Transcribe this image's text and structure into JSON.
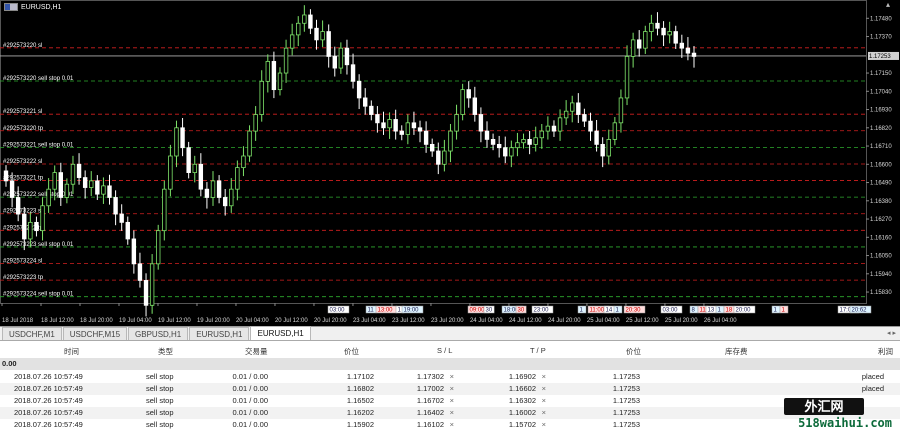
{
  "chart": {
    "symbol_title": "EURUSD,H1",
    "current_price": "1.17253",
    "price_ticks": [
      "1.17480",
      "1.17370",
      "1.17253",
      "1.17150",
      "1.17040",
      "1.16930",
      "1.16820",
      "1.16710",
      "1.16600",
      "1.16490",
      "1.16380",
      "1.16270",
      "1.16160",
      "1.16050",
      "1.15940",
      "1.15830"
    ],
    "order_lines": [
      {
        "label": "#292573220 sl",
        "price": 1.17302,
        "color": "#d42020"
      },
      {
        "label": "#292573220 sell stop 0.01",
        "price": 1.17102,
        "color": "#2eaa2e"
      },
      {
        "label": "#292573221 sl",
        "price": 1.16902,
        "color": "#d42020"
      },
      {
        "label": "#292573220 tp",
        "price": 1.16802,
        "color": "#d42020"
      },
      {
        "label": "#292573221 sell stop 0.01",
        "price": 1.16702,
        "color": "#2eaa2e"
      },
      {
        "label": "#292573222 sl",
        "price": 1.16602,
        "color": "#d42020"
      },
      {
        "label": "#292573221 tp",
        "price": 1.16502,
        "color": "#d42020"
      },
      {
        "label": "#292573222 sell stop 0.01",
        "price": 1.16402,
        "color": "#2eaa2e"
      },
      {
        "label": "#292573223 sl",
        "price": 1.16302,
        "color": "#d42020"
      },
      {
        "label": "#292573222 tp",
        "price": 1.16202,
        "color": "#d42020"
      },
      {
        "label": "#292573223 sell stop 0.01",
        "price": 1.16102,
        "color": "#2eaa2e"
      },
      {
        "label": "#292573224 sl",
        "price": 1.16002,
        "color": "#d42020"
      },
      {
        "label": "#292573223 tp",
        "price": 1.15902,
        "color": "#d42020"
      },
      {
        "label": "#292573224 sell stop 0.01",
        "price": 1.15802,
        "color": "#2eaa2e"
      }
    ],
    "time_labels": [
      "18 Jul 2018",
      "18 Jul 12:00",
      "18 Jul 20:00",
      "19 Jul 04:00",
      "19 Jul 12:00",
      "19 Jul 20:00",
      "20 Jul 04:00",
      "20 Jul 12:00",
      "20 Jul 20:00",
      "23 Jul 04:00",
      "23 Jul 12:00",
      "23 Jul 20:00",
      "24 Jul 04:00",
      "24 Jul 12:00",
      "24 Jul 20:00",
      "25 Jul 04:00",
      "25 Jul 12:00",
      "25 Jul 20:00",
      "26 Jul 04:00"
    ],
    "news_markers": [
      "03:00",
      "11",
      "13:00",
      "1",
      "19:00",
      "09:00",
      "30",
      "18:00",
      "30",
      "23:00",
      "1",
      "11:00",
      "14",
      "1",
      "20:30",
      "03:00",
      "8",
      "11",
      "13",
      "1",
      "18",
      "20:00",
      "1",
      "1",
      "17:00",
      "20:62"
    ],
    "candles_close": [
      1.165,
      1.164,
      1.163,
      1.1615,
      1.1625,
      1.162,
      1.1635,
      1.1645,
      1.1655,
      1.164,
      1.1648,
      1.166,
      1.1652,
      1.1646,
      1.165,
      1.1642,
      1.1647,
      1.164,
      1.163,
      1.1625,
      1.1615,
      1.16,
      1.159,
      1.1575,
      1.16,
      1.162,
      1.1645,
      1.1665,
      1.1682,
      1.167,
      1.1655,
      1.166,
      1.1645,
      1.164,
      1.165,
      1.164,
      1.1635,
      1.1645,
      1.1658,
      1.1665,
      1.168,
      1.169,
      1.171,
      1.1722,
      1.1705,
      1.1715,
      1.173,
      1.1738,
      1.1745,
      1.175,
      1.1742,
      1.1735,
      1.174,
      1.1725,
      1.1718,
      1.173,
      1.172,
      1.171,
      1.17,
      1.1695,
      1.169,
      1.1685,
      1.1682,
      1.1687,
      1.168,
      1.1678,
      1.1685,
      1.1682,
      1.168,
      1.1672,
      1.1668,
      1.166,
      1.1668,
      1.168,
      1.169,
      1.1705,
      1.17,
      1.169,
      1.168,
      1.1675,
      1.1672,
      1.167,
      1.1665,
      1.167,
      1.1673,
      1.1675,
      1.1672,
      1.1676,
      1.168,
      1.1683,
      1.168,
      1.1688,
      1.1692,
      1.1697,
      1.169,
      1.1686,
      1.168,
      1.1672,
      1.1665,
      1.1675,
      1.1685,
      1.17,
      1.1725,
      1.1735,
      1.173,
      1.174,
      1.1745,
      1.1742,
      1.1738,
      1.174,
      1.1733,
      1.173,
      1.1727,
      1.1725
    ]
  },
  "tabs": [
    {
      "label": "USDCHF,M1",
      "active": false
    },
    {
      "label": "USDCHF,M15",
      "active": false
    },
    {
      "label": "GBPUSD,H1",
      "active": false
    },
    {
      "label": "EURUSD,H1",
      "active": false
    },
    {
      "label": "EURUSD,H1",
      "active": true
    }
  ],
  "tab_nav": "◂ ▸",
  "orders": {
    "headers": {
      "time": "时间",
      "type": "类型",
      "volume": "交易量",
      "price": "价位",
      "sl": "S / L",
      "tp": "T / P",
      "cur_price": "价位",
      "swap": "库存费",
      "profit": "利润"
    },
    "group_value": "0.00",
    "rows": [
      {
        "time": "2018.07.26 10:57:49",
        "type": "sell stop",
        "volume": "0.01 / 0.00",
        "price": "1.17102",
        "sl": "1.17302",
        "tp": "1.16902",
        "cur_price": "1.17253",
        "status": "placed"
      },
      {
        "time": "2018.07.26 10:57:49",
        "type": "sell stop",
        "volume": "0.01 / 0.00",
        "price": "1.16802",
        "sl": "1.17002",
        "tp": "1.16602",
        "cur_price": "1.17253",
        "status": "placed"
      },
      {
        "time": "2018.07.26 10:57:49",
        "type": "sell stop",
        "volume": "0.01 / 0.00",
        "price": "1.16502",
        "sl": "1.16702",
        "tp": "1.16302",
        "cur_price": "1.17253",
        "status": ""
      },
      {
        "time": "2018.07.26 10:57:49",
        "type": "sell stop",
        "volume": "0.01 / 0.00",
        "price": "1.16202",
        "sl": "1.16402",
        "tp": "1.16002",
        "cur_price": "1.17253",
        "status": ""
      },
      {
        "time": "2018.07.26 10:57:49",
        "type": "sell stop",
        "volume": "0.01 / 0.00",
        "price": "1.15902",
        "sl": "1.16102",
        "tp": "1.15702",
        "cur_price": "1.17253",
        "status": ""
      }
    ],
    "remove_icon": "×"
  },
  "watermark": {
    "top": "外汇网",
    "bottom": "518waihui.com"
  }
}
